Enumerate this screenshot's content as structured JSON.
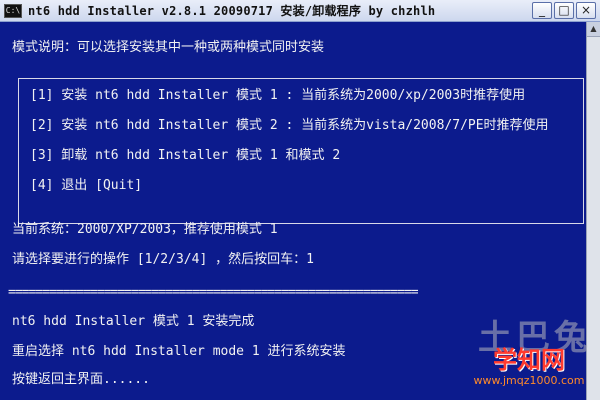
{
  "window": {
    "title": "nt6 hdd Installer v2.8.1 20090717 安装/卸载程序 by chzhlh",
    "app_icon": "console-icon",
    "buttons": {
      "minimize": "_",
      "maximize": "□",
      "close": "×"
    }
  },
  "console": {
    "intro": "模式说明：可以选择安装其中一种或两种模式同时安装",
    "options": [
      "[1] 安装 nt6 hdd Installer 模式 1 : 当前系统为2000/xp/2003时推荐使用",
      "[2] 安装 nt6 hdd Installer 模式 2 : 当前系统为vista/2008/7/PE时推荐使用",
      "[3] 卸载 nt6 hdd Installer 模式 1 和模式 2",
      "[4] 退出 [Quit]"
    ],
    "current_system": "当前系统：2000/XP/2003，推荐使用模式 1",
    "prompt": "请选择要进行的操作 [1/2/3/4] ，然后按回车：1",
    "separator": "============================================================",
    "result_lines": [
      "nt6 hdd Installer 模式 1 安装完成",
      "重启选择 nt6 hdd Installer mode 1 进行系统安装",
      "按键返回主界面......"
    ]
  },
  "watermark": {
    "gray_text": "土巴兔",
    "title": "学知网",
    "url": "www.jmqz1000.com",
    "title_color": "#ff3b2f",
    "url_color": "#ff8a2a"
  },
  "colors": {
    "console_bg": "#0c1b8d",
    "console_text": "#f2f2f2",
    "titlebar": "#dce3f3"
  }
}
